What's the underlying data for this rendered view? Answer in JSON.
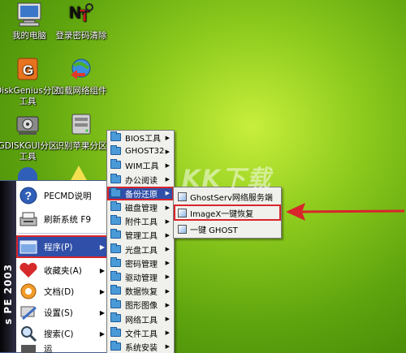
{
  "desktop_icons": [
    {
      "name": "my-computer",
      "label_lines": [
        "我的电脑"
      ],
      "icon": "computer-icon"
    },
    {
      "name": "login-password-clear",
      "label_lines": [
        "登录密码清除"
      ],
      "icon": "nt-key-icon"
    },
    {
      "name": "diskgenius",
      "label_lines": [
        "DiskGenius分区",
        "工具"
      ],
      "icon": "diskgenius-icon"
    },
    {
      "name": "load-network",
      "label_lines": [
        "加载网络组件"
      ],
      "icon": "network-globe-icon"
    },
    {
      "name": "gdiskgui",
      "label_lines": [
        "GDISKGUI分区",
        "工具"
      ],
      "icon": "gdisk-icon"
    },
    {
      "name": "apple-partition",
      "label_lines": [
        "识别苹果分区"
      ],
      "icon": "drive-icon"
    }
  ],
  "start_menu": {
    "strip_text": "s PE 2003",
    "items": [
      {
        "label": "PECMD说明",
        "icon": "help-icon"
      },
      {
        "label": "刷新系统 F9",
        "icon": "refresh-icon"
      },
      {
        "label": "程序(P)",
        "icon": "programs-icon",
        "arrow": "▶"
      },
      {
        "label": "收藏夹(A)",
        "icon": "favorites-icon",
        "arrow": "▶"
      },
      {
        "label": "文档(D)",
        "icon": "documents-icon",
        "arrow": "▶"
      },
      {
        "label": "设置(S)",
        "icon": "settings-icon",
        "arrow": "▶"
      },
      {
        "label": "搜索(C)",
        "icon": "search-icon",
        "arrow": "▶"
      },
      {
        "label": "运",
        "icon": "run-icon"
      }
    ]
  },
  "programs_submenu": [
    {
      "label": "BIOS工具",
      "arrow": "▶"
    },
    {
      "label": "GHOST32",
      "arrow": "▶"
    },
    {
      "label": "WIM工具",
      "arrow": "▶"
    },
    {
      "label": "办公阅读",
      "arrow": "▶"
    },
    {
      "label": "备份还原",
      "arrow": "▶"
    },
    {
      "label": "磁盘管理",
      "arrow": "▶"
    },
    {
      "label": "附件工具",
      "arrow": "▶"
    },
    {
      "label": "管理工具",
      "arrow": "▶"
    },
    {
      "label": "光盘工具",
      "arrow": "▶"
    },
    {
      "label": "密码管理",
      "arrow": "▶"
    },
    {
      "label": "驱动管理",
      "arrow": "▶"
    },
    {
      "label": "数据恢复",
      "arrow": "▶"
    },
    {
      "label": "图形图像",
      "arrow": "▶"
    },
    {
      "label": "网络工具",
      "arrow": "▶"
    },
    {
      "label": "文件工具",
      "arrow": "▶"
    },
    {
      "label": "系统安装",
      "arrow": "▶"
    }
  ],
  "backup_submenu": [
    {
      "label": "GhostServ网络服务端"
    },
    {
      "label": "ImageX一键恢复"
    },
    {
      "label": "一键 GHOST"
    }
  ],
  "watermark": "KK下载",
  "colors": {
    "highlight": "#2f4fa8",
    "annotation_red": "#d8252b",
    "desktop_green": "#7fbf17"
  }
}
